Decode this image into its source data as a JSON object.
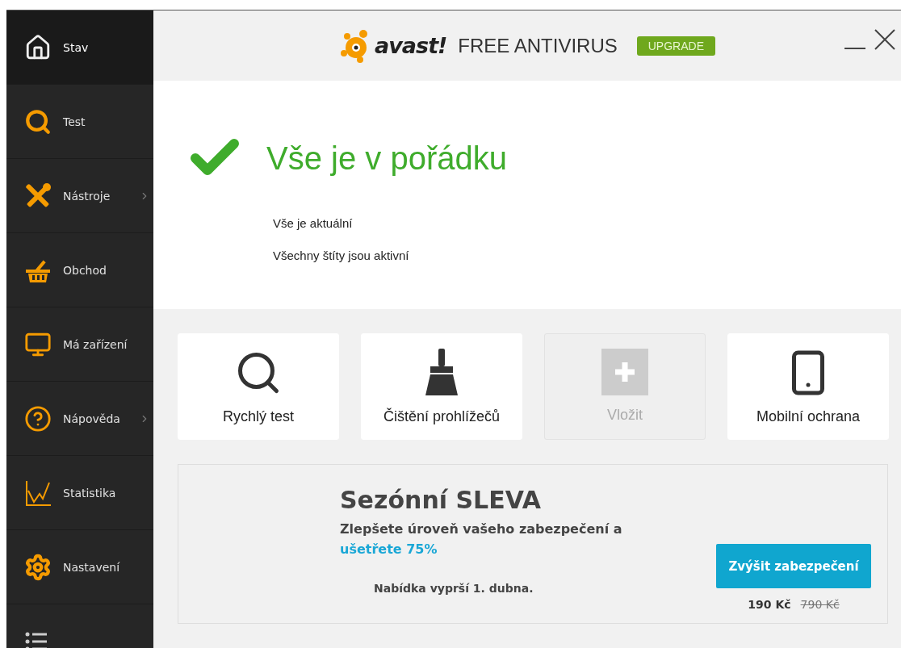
{
  "sidebar": {
    "items": [
      {
        "label": "Stav",
        "selected": true,
        "submenu": false
      },
      {
        "label": "Test",
        "selected": false,
        "submenu": false
      },
      {
        "label": "Nástroje",
        "selected": false,
        "submenu": true
      },
      {
        "label": "Obchod",
        "selected": false,
        "submenu": false
      },
      {
        "label": "Má zařízení",
        "selected": false,
        "submenu": false
      },
      {
        "label": "Nápověda",
        "selected": false,
        "submenu": true
      },
      {
        "label": "Statistika",
        "selected": false,
        "submenu": false
      },
      {
        "label": "Nastavení",
        "selected": false,
        "submenu": false
      }
    ]
  },
  "header": {
    "logo": "avast!",
    "product": "FREE ANTIVIRUS",
    "upgrade": "UPGRADE"
  },
  "status": {
    "title": "Vše je v pořádku",
    "lines": [
      "Vše je aktuální",
      "Všechny štíty jsou aktivní"
    ]
  },
  "tiles": [
    {
      "label": "Rychlý test",
      "disabled": false
    },
    {
      "label": "Čištění prohlížečů",
      "disabled": false
    },
    {
      "label": "Vložit",
      "disabled": true
    },
    {
      "label": "Mobilní ochrana",
      "disabled": false
    }
  ],
  "offer": {
    "title": "Sezónní SLEVA",
    "text": "Zlepšete úroveň vašeho zabezpečení a",
    "highlight": "ušetřete 75%",
    "expiry": "Nabídka vyprší 1. dubna.",
    "button": "Zvýšit zabezpečení",
    "price": "190 Kč",
    "old_price": "790 Kč"
  }
}
